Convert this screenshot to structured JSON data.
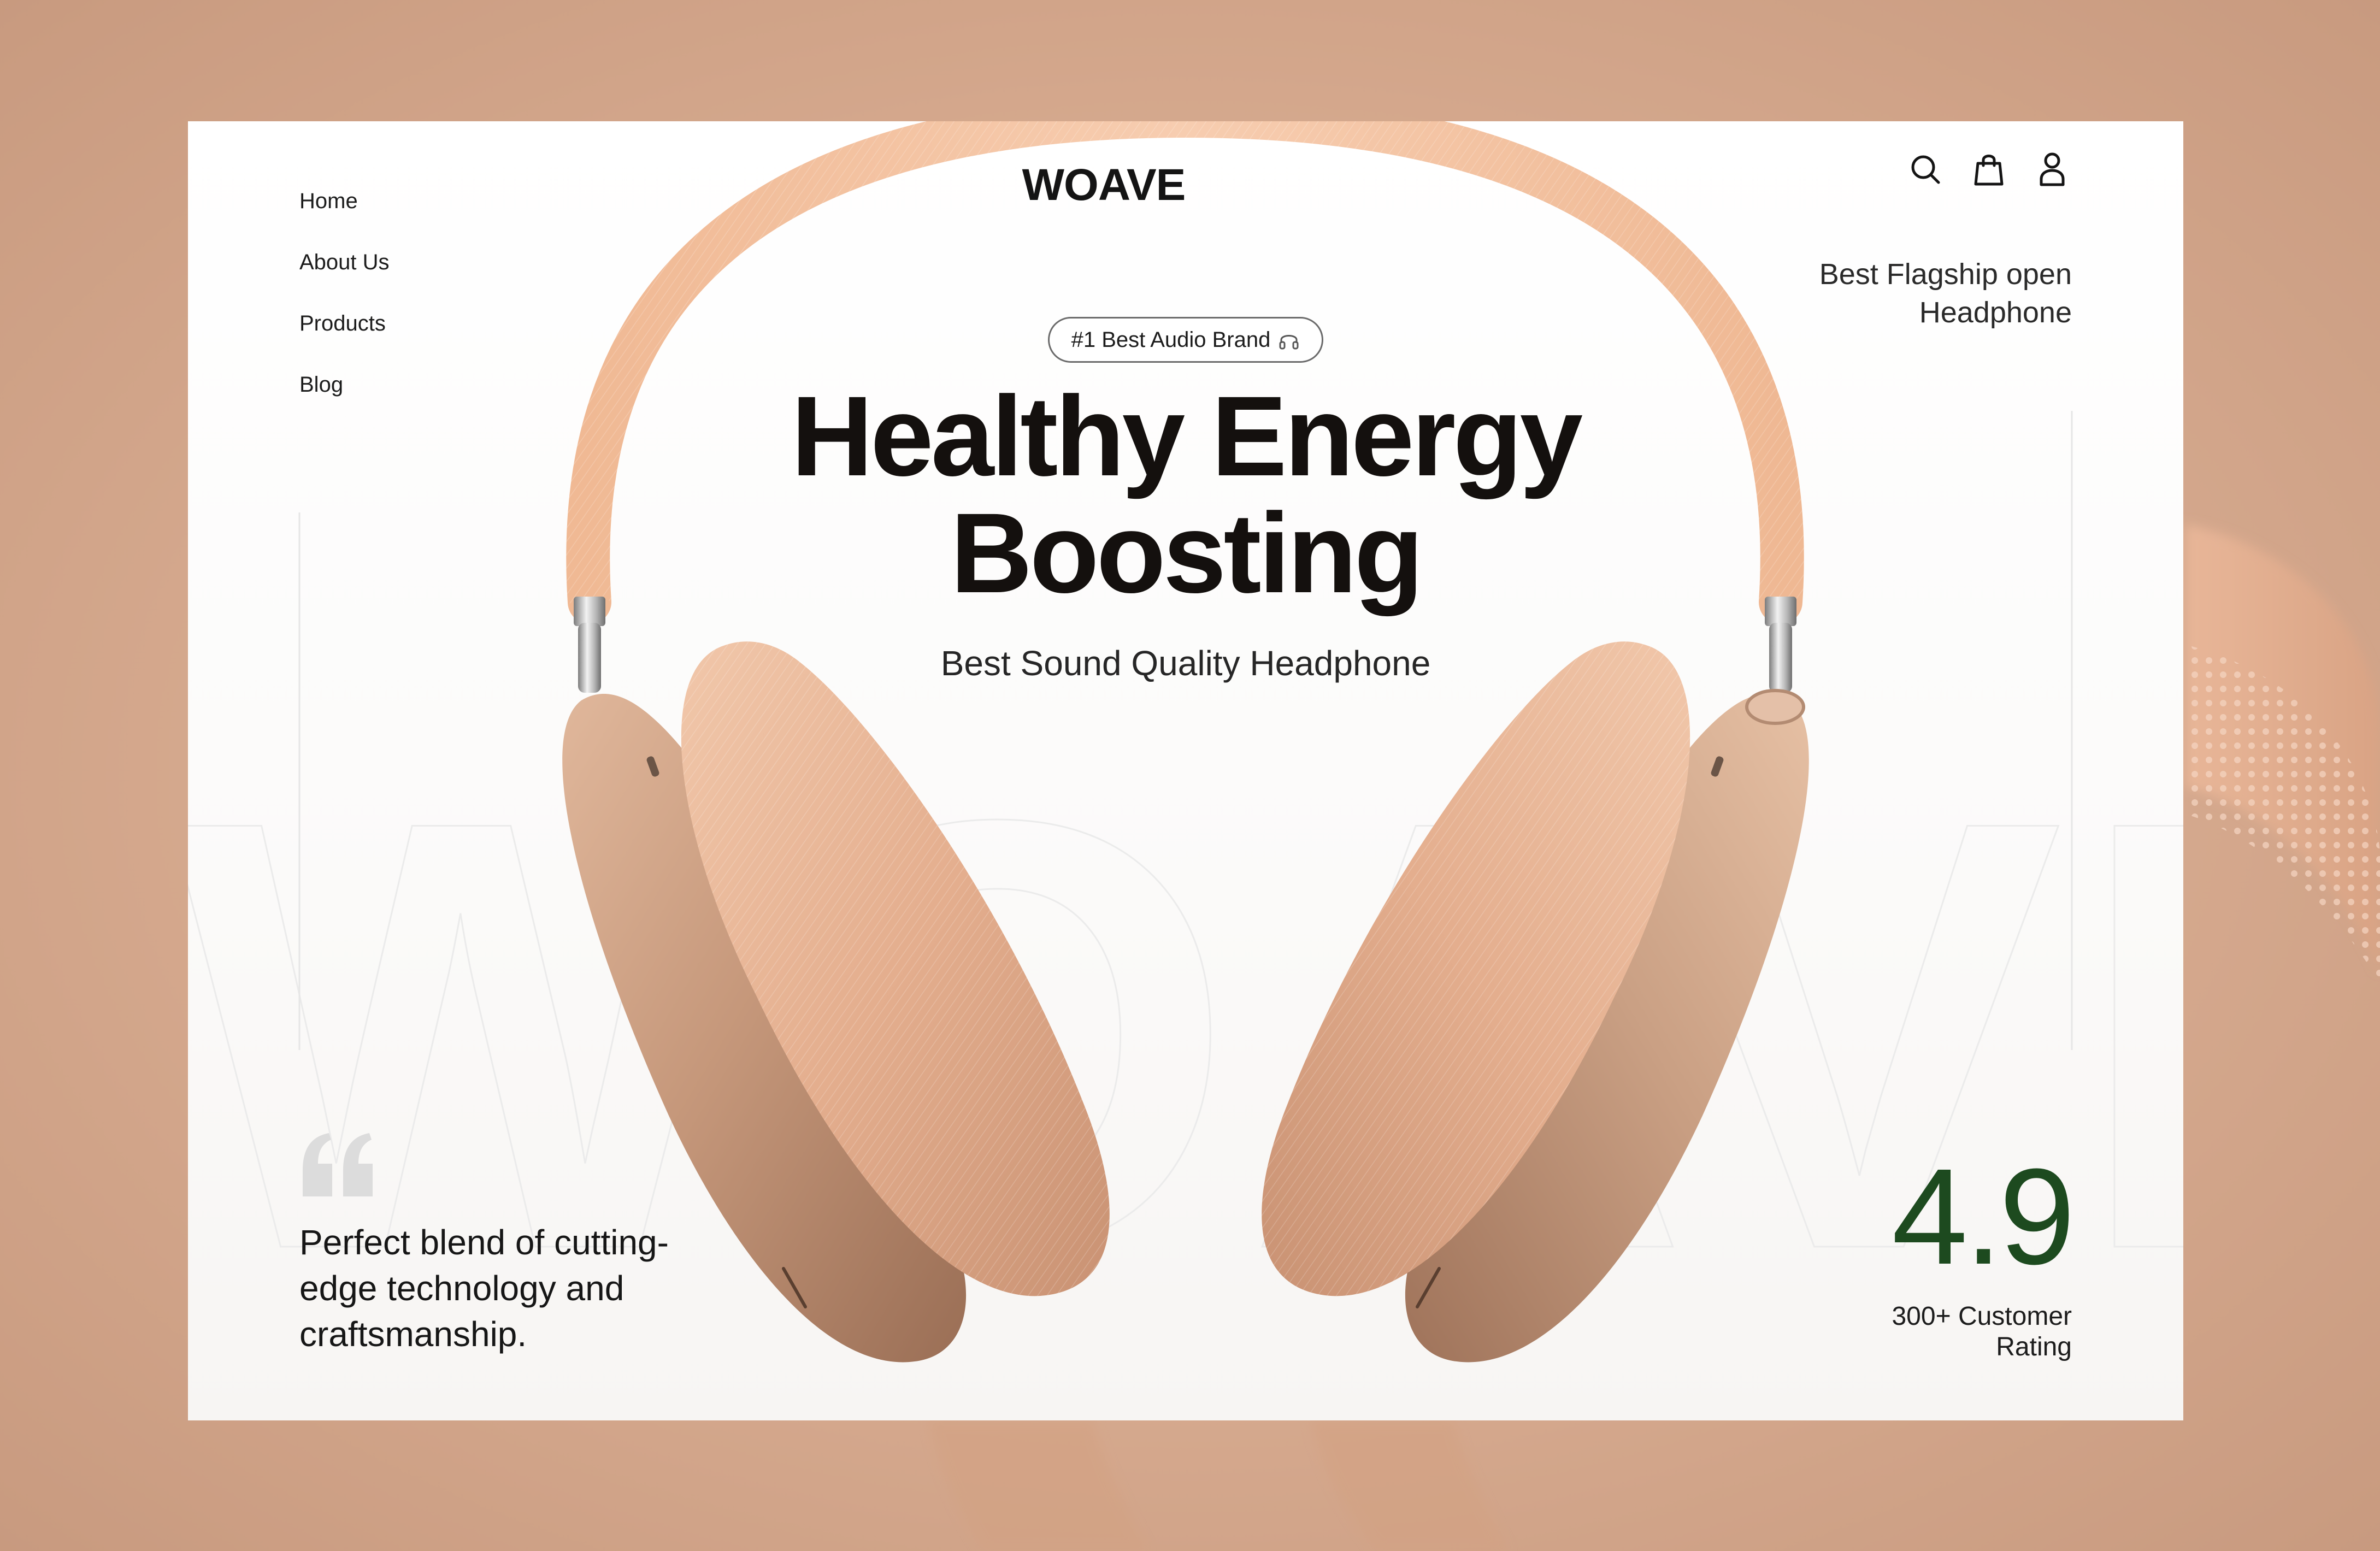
{
  "brand": {
    "logo": "WOAVE",
    "watermark": "WOAVE"
  },
  "nav": {
    "items": [
      {
        "label": "Home"
      },
      {
        "label": "About Us"
      },
      {
        "label": "Products"
      },
      {
        "label": "Blog"
      }
    ]
  },
  "header_icons": [
    "search-icon",
    "shopping-bag-icon",
    "user-icon"
  ],
  "promo": {
    "text": "Best Flagship open Headphone"
  },
  "hero": {
    "badge": "#1 Best Audio Brand",
    "badge_icon": "headphone-icon",
    "title_line1": "Healthy Energy",
    "title_line2": "Boosting",
    "subtitle": "Best Sound Quality Headphone"
  },
  "testimonial": {
    "text": "Perfect blend of cutting-edge technology and craftsmanship."
  },
  "rating": {
    "value": "4.9",
    "label": "300+ Customer Rating"
  },
  "colors": {
    "background": "#d9ad92",
    "card": "#ffffff",
    "text": "#14100e",
    "rating_green": "#1d4a1f",
    "headphone_band": "#efbb98",
    "cushion": "#e8b596",
    "shell": "#c8997a"
  }
}
